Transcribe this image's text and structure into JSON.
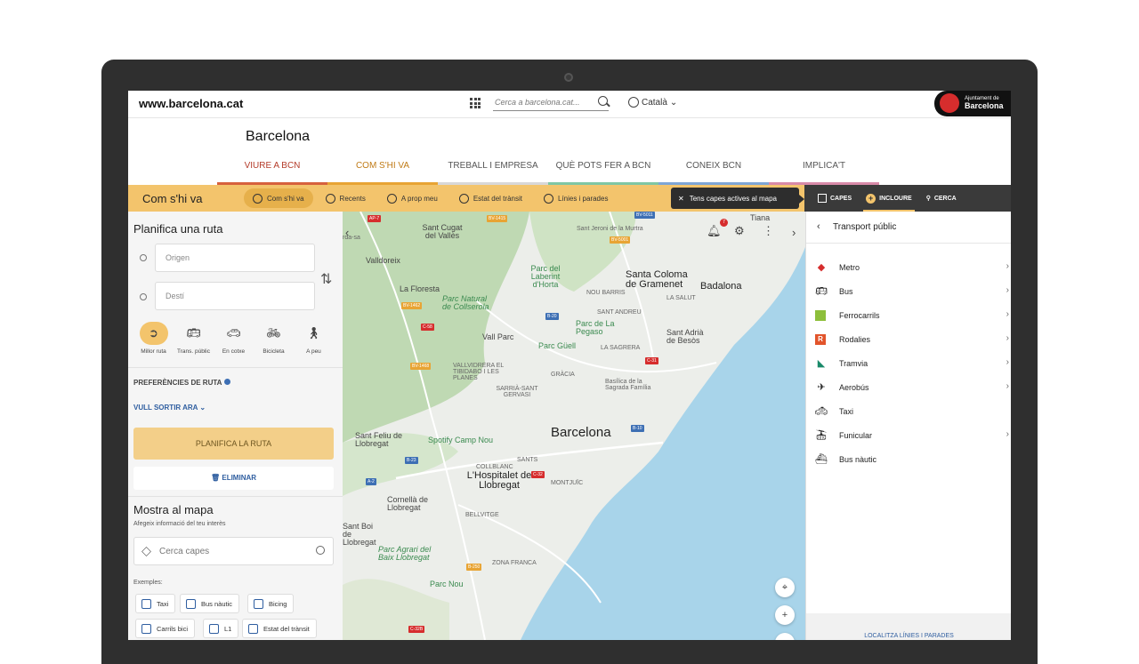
{
  "topbar": {
    "site_url": "www.barcelona.cat",
    "search_placeholder": "Cerca a barcelona.cat...",
    "language": "Català",
    "logo_small": "Ajuntament de",
    "logo_big": "Barcelona"
  },
  "header": {
    "site_title": "Barcelona",
    "nav": [
      "VIURE A BCN",
      "COM S'HI VA",
      "TREBALL I EMPRESA",
      "QUÈ POTS FER A BCN",
      "CONEIX BCN",
      "IMPLICA'T"
    ]
  },
  "section": {
    "title": "Com s'hi va",
    "subtabs": [
      "Com s'hi va",
      "Recents",
      "A prop meu",
      "Estat del trànsit",
      "Línies i parades"
    ],
    "tooltip": "Tens capes actives al mapa",
    "right_tabs": [
      "CAPES",
      "INCLOURE",
      "CERCA"
    ]
  },
  "route": {
    "title": "Planifica una ruta",
    "origin_placeholder": "Origen",
    "destination_placeholder": "Destí",
    "modes": [
      {
        "label": "Millor ruta",
        "icon": "best-route-icon"
      },
      {
        "label": "Trans. públic",
        "icon": "bus-icon"
      },
      {
        "label": "En cotxe",
        "icon": "car-icon"
      },
      {
        "label": "Bicicleta",
        "icon": "bicycle-icon"
      },
      {
        "label": "A peu",
        "icon": "walk-icon"
      }
    ],
    "preferences": "PREFERÈNCIES DE RUTA",
    "leave_now": "VULL SORTIR ARA",
    "plan_button": "PLANIFICA LA RUTA",
    "delete_button": "ELIMINAR"
  },
  "layers": {
    "title": "Mostra al mapa",
    "subtitle": "Afegeix informació del teu interès",
    "search_placeholder": "Cerca capes",
    "examples_label": "Exemples:",
    "examples": [
      "Taxi",
      "Bus nàutic",
      "Bicing",
      "Carrils bici",
      "L1",
      "Estat del trànsit"
    ]
  },
  "map": {
    "labels": {
      "tiana": "Tiana",
      "sant_cugat": "Sant Cugat del Vallès",
      "sant_jeroni": "Sant Jeroni de la Murtra",
      "valldoreix": "Valldoreix",
      "parc_laberint": "Parc del Laberint d'Horta",
      "santa_coloma": "Santa Coloma de Gramenet",
      "badalona": "Badalona",
      "la_floresta": "La Floresta",
      "parc_collserola": "Parc Natural de Collserola",
      "nou_barris": "NOU BARRIS",
      "la_salut": "LA SALUT",
      "sant_andreu": "SANT ANDREU",
      "la_pegaso": "Parc de La Pegaso",
      "sant_adria": "Sant Adrià de Besòs",
      "vall_parc": "Vall Parc",
      "parc_guell": "Parc Güell",
      "la_sagrera": "LA SAGRERA",
      "vallvidrera": "VALLVIDRERA EL TIBIDABO I LES PLANES",
      "sarria": "SARRIÀ-SANT GERVASI",
      "gracia": "GRÀCIA",
      "sagrada": "Basílica de la Sagrada Família",
      "barcelona": "Barcelona",
      "sant_feliu": "Sant Feliu de Llobregat",
      "spotify": "Spotify Camp Nou",
      "collblanc": "COLLBLANC",
      "sants": "SANTS",
      "hospitalet": "L'Hospitalet de Llobregat",
      "montjuic": "MONTJUÏC",
      "cornella": "Cornellà de Llobregat",
      "bellvitge": "BELLVITGE",
      "boi": "Sant Boi de Llobregat",
      "parc_agrari": "Parc Agrari del Baix Llobregat",
      "zona_franca": "ZONA FRANCA",
      "parc_nou": "Parc Nou",
      "rda_sa": "rda-sa"
    },
    "roads": [
      "BV-1415",
      "BV-5011",
      "BV-5001",
      "BV-1462",
      "B-20",
      "C-58",
      "C-31",
      "B-10",
      "B-23",
      "A-2",
      "C-32B",
      "B-250",
      "C-32",
      "AP-7",
      "BV-1468"
    ],
    "notification_count": "7"
  },
  "transport": {
    "title": "Transport públic",
    "items": [
      {
        "label": "Metro",
        "icon": "metro-icon",
        "color": "#d62d2d",
        "has_children": true
      },
      {
        "label": "Bus",
        "icon": "bus-icon",
        "color": "#333333",
        "has_children": true
      },
      {
        "label": "Ferrocarrils",
        "icon": "ferrocarrils-icon",
        "color": "#8dbf3b",
        "has_children": true
      },
      {
        "label": "Rodalies",
        "icon": "rodalies-icon",
        "color": "#e2542b",
        "has_children": true
      },
      {
        "label": "Tramvia",
        "icon": "tramvia-icon",
        "color": "#1a8a6a",
        "has_children": true
      },
      {
        "label": "Aerobús",
        "icon": "plane-icon",
        "color": "#333333",
        "has_children": true
      },
      {
        "label": "Taxi",
        "icon": "taxi-icon",
        "color": "#333333",
        "has_children": false
      },
      {
        "label": "Funicular",
        "icon": "funicular-icon",
        "color": "#333333",
        "has_children": true
      },
      {
        "label": "Bus nàutic",
        "icon": "boat-icon",
        "color": "#333333",
        "has_children": false
      }
    ],
    "footer": "LOCALITZA LÍNIES I PARADES"
  },
  "colors": {
    "accent": "#f3c46c",
    "link": "#2f5ea0",
    "brand_red": "#d62d2d",
    "dark": "#3a3a3a"
  }
}
